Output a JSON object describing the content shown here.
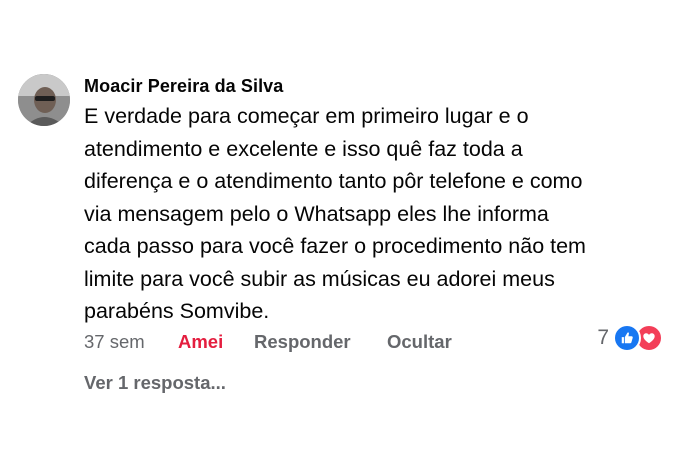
{
  "comment": {
    "author": "Moacir Pereira da Silva",
    "lines": [
      "E verdade para começar em primeiro lugar e o",
      "atendimento e excelente e isso quê faz toda a",
      "diferença e o atendimento tanto pôr telefone e como",
      "via mensagem pelo o Whatsapp eles lhe informa",
      "cada passo para você fazer o procedimento não tem",
      "limite para você subir as músicas eu adorei meus",
      "parabéns Somvibe."
    ],
    "time": "37 sem",
    "reaction_label": "Amei",
    "reply_label": "Responder",
    "hide_label": "Ocultar",
    "reaction_count": "7",
    "reaction_icons": [
      "like-icon",
      "love-icon"
    ],
    "view_replies": "Ver 1 resposta..."
  },
  "colors": {
    "text": "#050505",
    "secondary": "#65676b",
    "love_red": "#e41e3f",
    "like_blue": "#1877f2",
    "heart_red": "#f33e58"
  }
}
